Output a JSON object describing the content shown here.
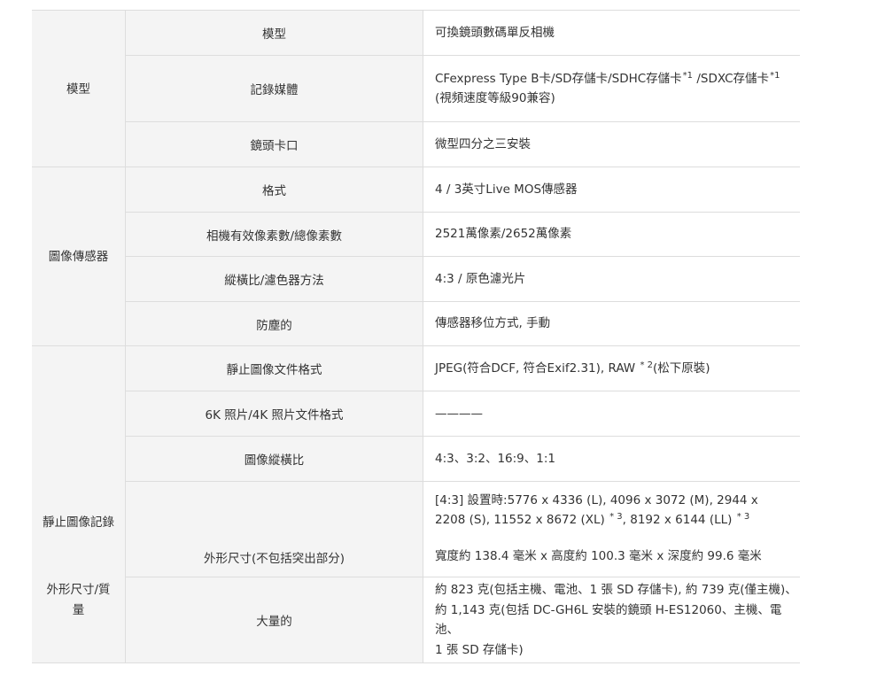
{
  "categories": {
    "model": "模型",
    "sensor": "圖像傳感器",
    "still": "靜止圖像記錄",
    "dims_line1": "外形尺寸/質",
    "dims_line2": "量"
  },
  "rows": {
    "model_type": {
      "label": "模型",
      "value": "可換鏡頭數碼單反相機"
    },
    "media": {
      "label": "記錄媒體",
      "value_a": "CFexpress Type B卡/SD存儲卡/SDHC存儲卡",
      "sup_a": "*1",
      "value_b": "/SDXC存儲卡",
      "sup_b": "*1",
      "value_line2": "(視頻速度等級90兼容)"
    },
    "mount": {
      "label": "鏡頭卡口",
      "value": "微型四分之三安裝"
    },
    "format": {
      "label": "格式",
      "value": "4 / 3英寸Live MOS傳感器"
    },
    "pixels": {
      "label": "相機有效像素數/總像素數",
      "value": "2521萬像素/2652萬像素"
    },
    "aspect_filter": {
      "label": "縱橫比/濾色器方法",
      "value": "4:3 / 原色濾光片"
    },
    "dust": {
      "label": "防塵的",
      "value": "傳感器移位方式, 手動"
    },
    "still_format": {
      "label": "靜止圖像文件格式",
      "value_a": "JPEG(符合DCF, 符合Exif2.31), RAW",
      "sup": "* 2",
      "value_b": "(松下原裝)"
    },
    "photo_format": {
      "label": "6K 照片/4K 照片文件格式",
      "value": "————"
    },
    "image_aspect": {
      "label": "圖像縱橫比",
      "value": "4:3、3:2、16:9、1:1"
    },
    "image_size": {
      "line1": "[4:3] 設置時:5776 x 4336 (L), 4096 x 3072 (M), 2944 x",
      "line2_a": "2208 (S), 11552 x 8672 (XL)",
      "sup_a": "* 3",
      "line2_b": ", 8192 x 6144 (LL)",
      "sup_b": "* 3"
    },
    "dimensions": {
      "label": "外形尺寸(不包括突出部分)",
      "value": "寬度約 138.4 毫米 x 高度約 100.3 毫米 x 深度約 99.6 毫米"
    },
    "weight": {
      "label": "大量的",
      "line1": "約 823 克(包括主機、電池、1 張 SD 存儲卡), 約 739 克(僅主機)、",
      "line2": "約 1,143 克(包括 DC-GH6L 安裝的鏡頭 H-ES12060、主機、電池、",
      "line3": "1 張 SD 存儲卡)"
    }
  }
}
